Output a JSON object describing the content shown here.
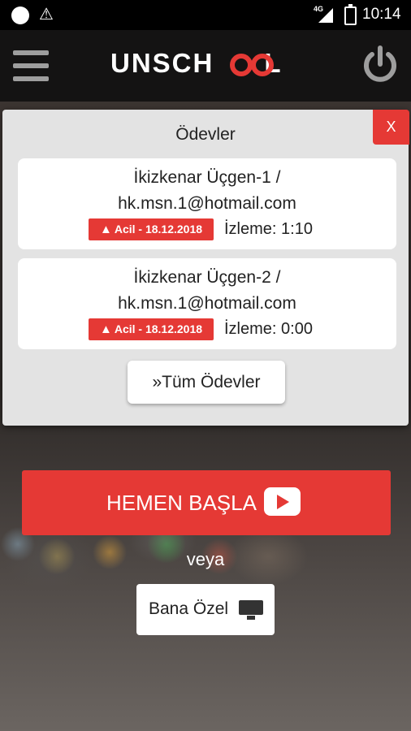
{
  "status_bar": {
    "network": "4G",
    "time": "10:14"
  },
  "app_bar": {
    "logo": "UNSCH",
    "logo_tail": "L"
  },
  "panel": {
    "title": "Ödevler",
    "close_label": "X",
    "items": [
      {
        "line1": "İkizkenar Üçgen-1 /",
        "line2": "hk.msn.1@hotmail.com",
        "badge": "Acil - 18.12.2018",
        "views": "İzleme: 1:10"
      },
      {
        "line1": "İkizkenar Üçgen-2 /",
        "line2": "hk.msn.1@hotmail.com",
        "badge": "Acil - 18.12.2018",
        "views": "İzleme: 0:00"
      }
    ],
    "all_button": "»Tüm Ödevler"
  },
  "start_button": "HEMEN BAŞLA",
  "or_text": "veya",
  "mine_button": "Bana Özel",
  "colors": {
    "accent": "#e53935",
    "appbar": "#141313"
  }
}
